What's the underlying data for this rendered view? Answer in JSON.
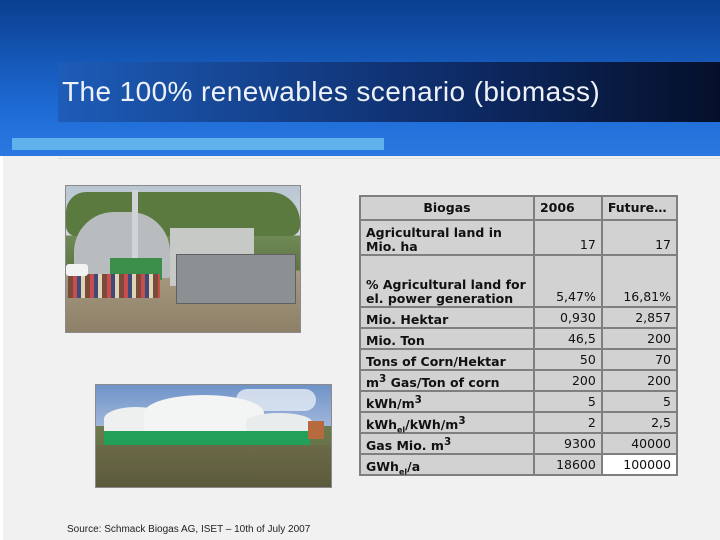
{
  "slide": {
    "title": "The 100% renewables scenario (biomass)",
    "source": "Source: Schmack Biogas AG, ISET – 10th of July 2007",
    "colors": {
      "header_blue": "#1e6bd6",
      "accent": "#5fb2ec",
      "title_text": "#eef2f8"
    }
  },
  "table": {
    "headers": [
      "Biogas",
      "2006",
      "Future…"
    ],
    "rows": [
      {
        "label": "Agricultural land in Mio. ha",
        "v2006": "17",
        "future": "17"
      },
      {
        "label": "% Agricultural land for el. power generation",
        "v2006": "5,47%",
        "future": "16,81%"
      },
      {
        "label": "Mio. Hektar",
        "v2006": "0,930",
        "future": "2,857"
      },
      {
        "label": "Mio. Ton",
        "v2006": "46,5",
        "future": "200"
      },
      {
        "label": "Tons of Corn/Hektar",
        "v2006": "50",
        "future": "70"
      },
      {
        "label_pre": "m",
        "label_sup": "3",
        "label_post": " Gas/Ton of corn",
        "v2006": "200",
        "future": "200"
      },
      {
        "label_pre": "kWh/m",
        "label_sup": "3",
        "v2006": "5",
        "future": "5"
      },
      {
        "label_pre": "kWh",
        "label_sub": "el",
        "label_mid": "/kWh/m",
        "label_sup": "3",
        "v2006": "2",
        "future": "2,5"
      },
      {
        "label_pre": "Gas Mio. m",
        "label_sup": "3",
        "v2006": "9300",
        "future": "40000"
      },
      {
        "label_pre": "GWh",
        "label_sub": "el",
        "label_post": "/a",
        "v2006": "18600",
        "future": "100000"
      }
    ]
  }
}
